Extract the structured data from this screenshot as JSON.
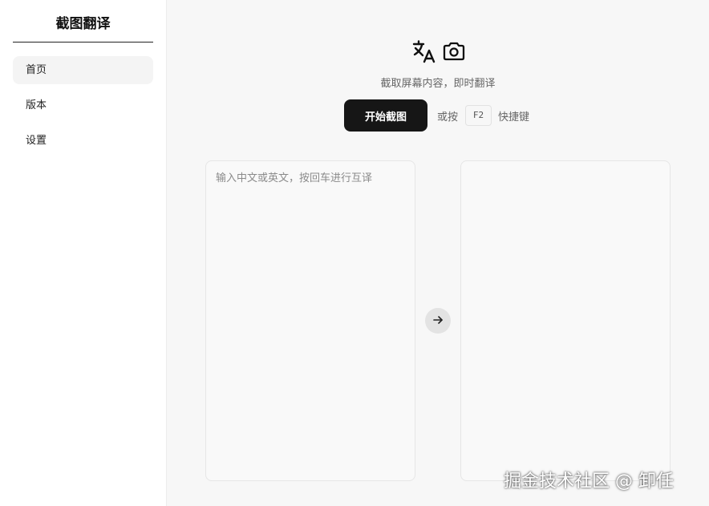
{
  "sidebar": {
    "title": "截图翻译",
    "items": [
      {
        "label": "首页",
        "active": true
      },
      {
        "label": "版本",
        "active": false
      },
      {
        "label": "设置",
        "active": false
      }
    ]
  },
  "hero": {
    "icons": [
      "translate-icon",
      "camera-icon"
    ],
    "subtitle": "截取屏幕内容，即时翻译",
    "start_button": "开始截图",
    "hint_prefix": "或按",
    "shortcut_key": "F2",
    "hint_suffix": "快捷键"
  },
  "translator": {
    "input_placeholder": "输入中文或英文，按回车进行互译",
    "input_value": "",
    "output_value": ""
  },
  "watermark": "掘金技术社区 @ 卸任",
  "colors": {
    "primary_button": "#161616",
    "sidebar_bg": "#ffffff",
    "main_bg": "#f7f7f7",
    "active_item_bg": "#f4f4f4"
  }
}
